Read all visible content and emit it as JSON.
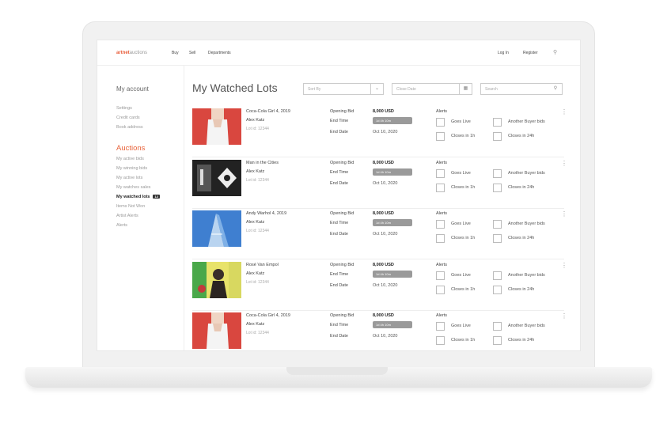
{
  "nav": {
    "logo_brand": "artnet",
    "logo_sub": "auctions",
    "links": [
      "Buy",
      "Sell",
      "Departments"
    ],
    "login": "Log In",
    "register": "Register",
    "search_icon": "search-icon"
  },
  "sidebar": {
    "title": "My account",
    "account_items": [
      "Settings",
      "Credit cards",
      "Book address"
    ],
    "section": "Auctions",
    "auction_items": [
      "My active bids",
      "My winning bids",
      "My active lots",
      "My watches sales",
      "My watched lots",
      "Items Not Won",
      "Artist Alerts",
      "Alerts"
    ],
    "active_index": 4,
    "active_badge": "12"
  },
  "main": {
    "title": "My Watched Lots",
    "sort_placeholder": "Sort By",
    "date_placeholder": "Close Date",
    "search_placeholder": "Search"
  },
  "lot_labels": {
    "opening_bid": "Opening Bid",
    "end_time": "End Time",
    "end_date": "End Date",
    "alerts": "Alerts",
    "goes_live": "Goes Live",
    "another_buyer": "Another Buyer bids",
    "closes_1h": "Closes in 1h",
    "closes_24h": "Closes in 24h",
    "end_time_pill": "1d 4h 10m"
  },
  "lots": [
    {
      "title": "Coca-Cola Girl 4, 2019",
      "artist": "Alex Katz",
      "lot_no": "Lot id: 12344",
      "bid": "8,000 USD",
      "end_date": "Oct 10, 2020",
      "image": "red-portrait"
    },
    {
      "title": "Man in the Cities",
      "artist": "Alex Katz",
      "lot_no": "Lot id: 12344",
      "bid": "8,000 USD",
      "end_date": "Oct 10, 2020",
      "image": "bw-graphic"
    },
    {
      "title": "Andy Warhol 4, 2019",
      "artist": "Alex Katz",
      "lot_no": "Lot id: 12344",
      "bid": "8,000 USD",
      "end_date": "Oct 10, 2020",
      "image": "blue-building"
    },
    {
      "title": "Rosé Van Empol",
      "artist": "Alex Katz",
      "lot_no": "Lot id: 12344",
      "bid": "8,000 USD",
      "end_date": "Oct 10, 2020",
      "image": "green-figure"
    },
    {
      "title": "Coca-Cola Girl 4, 2019",
      "artist": "Alex Katz",
      "lot_no": "Lot id: 12344",
      "bid": "8,000 USD",
      "end_date": "Oct 10, 2020",
      "image": "red-portrait"
    }
  ]
}
